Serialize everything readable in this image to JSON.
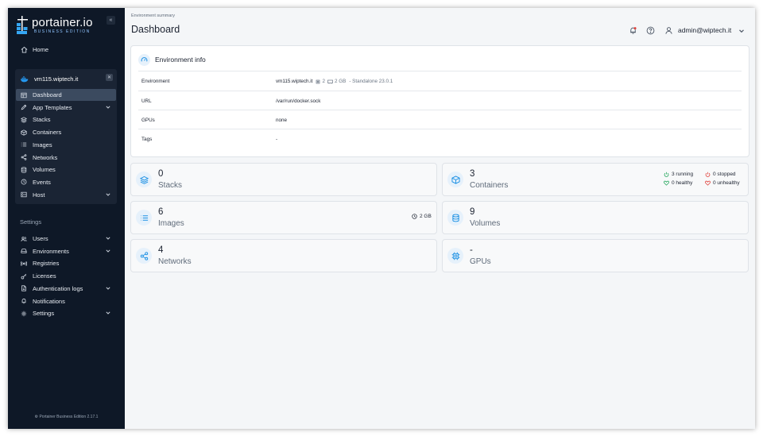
{
  "brand": {
    "name": "portainer.io",
    "edition": "BUSINESS EDITION"
  },
  "sidebar": {
    "home": "Home",
    "environment": {
      "name": "vm115.wiptech.it",
      "items": [
        {
          "label": "Dashboard",
          "icon": "dashboard-icon",
          "active": true
        },
        {
          "label": "App Templates",
          "icon": "edit-icon",
          "chevron": true
        },
        {
          "label": "Stacks",
          "icon": "stack-icon"
        },
        {
          "label": "Containers",
          "icon": "box-icon"
        },
        {
          "label": "Images",
          "icon": "list-icon"
        },
        {
          "label": "Networks",
          "icon": "share-icon"
        },
        {
          "label": "Volumes",
          "icon": "database-icon"
        },
        {
          "label": "Events",
          "icon": "clock-icon"
        },
        {
          "label": "Host",
          "icon": "server-icon",
          "chevron": true
        }
      ]
    },
    "settings_heading": "Settings",
    "settings_items": [
      {
        "label": "Users",
        "icon": "users-icon",
        "chevron": true
      },
      {
        "label": "Environments",
        "icon": "hdd-icon",
        "chevron": true
      },
      {
        "label": "Registries",
        "icon": "radio-icon"
      },
      {
        "label": "Licenses",
        "icon": "key-icon"
      },
      {
        "label": "Authentication logs",
        "icon": "file-icon",
        "chevron": true
      },
      {
        "label": "Notifications",
        "icon": "bell-icon"
      },
      {
        "label": "Settings",
        "icon": "gear-icon",
        "chevron": true
      }
    ],
    "footer": "Portainer Business Edition 2.17.1"
  },
  "header": {
    "breadcrumb": "Environment summary",
    "title": "Dashboard",
    "user": "admin@wiptech.it"
  },
  "environment_info": {
    "title": "Environment info",
    "rows": [
      {
        "label": "Environment",
        "value": "vm115.wiptech.it",
        "cpu": "2",
        "memory": "2 GB",
        "meta": "- Standalone 23.0.1"
      },
      {
        "label": "URL",
        "value": "/var/run/docker.sock"
      },
      {
        "label": "GPUs",
        "value": "none"
      },
      {
        "label": "Tags",
        "value": "-"
      }
    ]
  },
  "stats": {
    "stacks": {
      "value": "0",
      "label": "Stacks"
    },
    "containers": {
      "value": "3",
      "label": "Containers",
      "running": "3 running",
      "stopped": "0 stopped",
      "healthy": "0 healthy",
      "unhealthy": "0 unhealthy"
    },
    "images": {
      "value": "6",
      "label": "Images",
      "size": "2 GB"
    },
    "volumes": {
      "value": "9",
      "label": "Volumes"
    },
    "networks": {
      "value": "4",
      "label": "Networks"
    },
    "gpus": {
      "value": "-",
      "label": "GPUs"
    }
  },
  "colors": {
    "sidebar_bg": "#0e1827",
    "accent": "#1a8fe3",
    "running": "#22a55b",
    "stopped": "#e0403a"
  }
}
